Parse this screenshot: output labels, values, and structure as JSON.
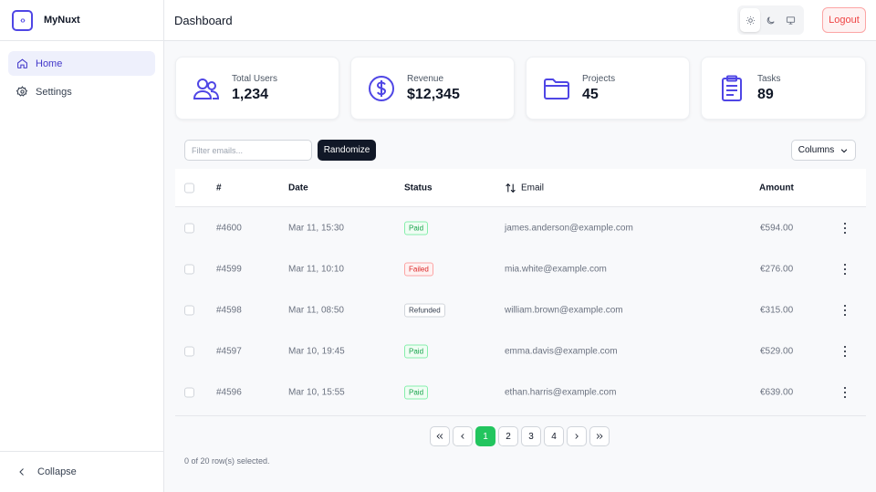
{
  "app": {
    "brand": "MyNuxt",
    "logo_glyph": "‹›"
  },
  "sidebar": {
    "items": [
      {
        "label": "Home",
        "icon": "home-icon",
        "active": true
      },
      {
        "label": "Settings",
        "icon": "gear-icon",
        "active": false
      }
    ],
    "collapse_label": "Collapse"
  },
  "header": {
    "title": "Dashboard",
    "theme_modes": [
      "sun-icon",
      "moon-icon",
      "monitor-icon"
    ],
    "active_theme": "sun-icon",
    "logout_label": "Logout"
  },
  "stats": [
    {
      "label": "Total Users",
      "value": "1,234",
      "icon": "users-icon"
    },
    {
      "label": "Revenue",
      "value": "$12,345",
      "icon": "dollar-icon"
    },
    {
      "label": "Projects",
      "value": "45",
      "icon": "folder-icon"
    },
    {
      "label": "Tasks",
      "value": "89",
      "icon": "clipboard-icon"
    }
  ],
  "toolbar": {
    "filter_placeholder": "Filter emails...",
    "filter_value": "",
    "randomize_label": "Randomize",
    "columns_label": "Columns"
  },
  "table": {
    "headers": {
      "id": "#",
      "date": "Date",
      "status": "Status",
      "email": "Email",
      "amount": "Amount"
    },
    "rows": [
      {
        "id": "#4600",
        "date": "Mar 11, 15:30",
        "status": "Paid",
        "email": "james.anderson@example.com",
        "amount": "€594.00"
      },
      {
        "id": "#4599",
        "date": "Mar 11, 10:10",
        "status": "Failed",
        "email": "mia.white@example.com",
        "amount": "€276.00"
      },
      {
        "id": "#4598",
        "date": "Mar 11, 08:50",
        "status": "Refunded",
        "email": "william.brown@example.com",
        "amount": "€315.00"
      },
      {
        "id": "#4597",
        "date": "Mar 10, 19:45",
        "status": "Paid",
        "email": "emma.davis@example.com",
        "amount": "€529.00"
      },
      {
        "id": "#4596",
        "date": "Mar 10, 15:55",
        "status": "Paid",
        "email": "ethan.harris@example.com",
        "amount": "€639.00"
      }
    ]
  },
  "pagination": {
    "pages": [
      "1",
      "2",
      "3",
      "4"
    ],
    "current": "1"
  },
  "footer": {
    "selected_text": "0 of 20 row(s) selected."
  },
  "colors": {
    "accent": "#4f46e5",
    "success": "#22c55e",
    "danger": "#ef4444",
    "dark": "#111827"
  }
}
